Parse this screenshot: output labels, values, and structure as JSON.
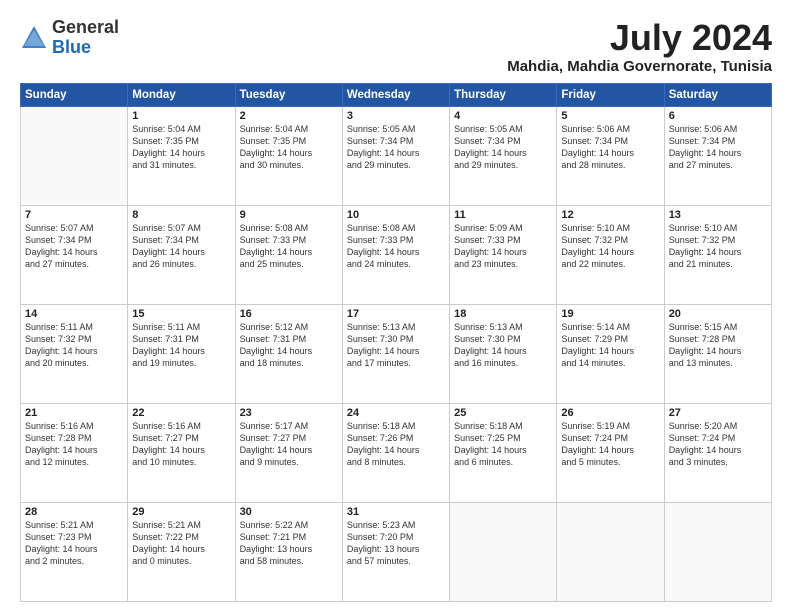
{
  "header": {
    "logo_general": "General",
    "logo_blue": "Blue",
    "month_year": "July 2024",
    "location": "Mahdia, Mahdia Governorate, Tunisia"
  },
  "calendar": {
    "days_of_week": [
      "Sunday",
      "Monday",
      "Tuesday",
      "Wednesday",
      "Thursday",
      "Friday",
      "Saturday"
    ],
    "weeks": [
      [
        {
          "num": "",
          "info": ""
        },
        {
          "num": "1",
          "info": "Sunrise: 5:04 AM\nSunset: 7:35 PM\nDaylight: 14 hours\nand 31 minutes."
        },
        {
          "num": "2",
          "info": "Sunrise: 5:04 AM\nSunset: 7:35 PM\nDaylight: 14 hours\nand 30 minutes."
        },
        {
          "num": "3",
          "info": "Sunrise: 5:05 AM\nSunset: 7:34 PM\nDaylight: 14 hours\nand 29 minutes."
        },
        {
          "num": "4",
          "info": "Sunrise: 5:05 AM\nSunset: 7:34 PM\nDaylight: 14 hours\nand 29 minutes."
        },
        {
          "num": "5",
          "info": "Sunrise: 5:06 AM\nSunset: 7:34 PM\nDaylight: 14 hours\nand 28 minutes."
        },
        {
          "num": "6",
          "info": "Sunrise: 5:06 AM\nSunset: 7:34 PM\nDaylight: 14 hours\nand 27 minutes."
        }
      ],
      [
        {
          "num": "7",
          "info": "Sunrise: 5:07 AM\nSunset: 7:34 PM\nDaylight: 14 hours\nand 27 minutes."
        },
        {
          "num": "8",
          "info": "Sunrise: 5:07 AM\nSunset: 7:34 PM\nDaylight: 14 hours\nand 26 minutes."
        },
        {
          "num": "9",
          "info": "Sunrise: 5:08 AM\nSunset: 7:33 PM\nDaylight: 14 hours\nand 25 minutes."
        },
        {
          "num": "10",
          "info": "Sunrise: 5:08 AM\nSunset: 7:33 PM\nDaylight: 14 hours\nand 24 minutes."
        },
        {
          "num": "11",
          "info": "Sunrise: 5:09 AM\nSunset: 7:33 PM\nDaylight: 14 hours\nand 23 minutes."
        },
        {
          "num": "12",
          "info": "Sunrise: 5:10 AM\nSunset: 7:32 PM\nDaylight: 14 hours\nand 22 minutes."
        },
        {
          "num": "13",
          "info": "Sunrise: 5:10 AM\nSunset: 7:32 PM\nDaylight: 14 hours\nand 21 minutes."
        }
      ],
      [
        {
          "num": "14",
          "info": "Sunrise: 5:11 AM\nSunset: 7:32 PM\nDaylight: 14 hours\nand 20 minutes."
        },
        {
          "num": "15",
          "info": "Sunrise: 5:11 AM\nSunset: 7:31 PM\nDaylight: 14 hours\nand 19 minutes."
        },
        {
          "num": "16",
          "info": "Sunrise: 5:12 AM\nSunset: 7:31 PM\nDaylight: 14 hours\nand 18 minutes."
        },
        {
          "num": "17",
          "info": "Sunrise: 5:13 AM\nSunset: 7:30 PM\nDaylight: 14 hours\nand 17 minutes."
        },
        {
          "num": "18",
          "info": "Sunrise: 5:13 AM\nSunset: 7:30 PM\nDaylight: 14 hours\nand 16 minutes."
        },
        {
          "num": "19",
          "info": "Sunrise: 5:14 AM\nSunset: 7:29 PM\nDaylight: 14 hours\nand 14 minutes."
        },
        {
          "num": "20",
          "info": "Sunrise: 5:15 AM\nSunset: 7:28 PM\nDaylight: 14 hours\nand 13 minutes."
        }
      ],
      [
        {
          "num": "21",
          "info": "Sunrise: 5:16 AM\nSunset: 7:28 PM\nDaylight: 14 hours\nand 12 minutes."
        },
        {
          "num": "22",
          "info": "Sunrise: 5:16 AM\nSunset: 7:27 PM\nDaylight: 14 hours\nand 10 minutes."
        },
        {
          "num": "23",
          "info": "Sunrise: 5:17 AM\nSunset: 7:27 PM\nDaylight: 14 hours\nand 9 minutes."
        },
        {
          "num": "24",
          "info": "Sunrise: 5:18 AM\nSunset: 7:26 PM\nDaylight: 14 hours\nand 8 minutes."
        },
        {
          "num": "25",
          "info": "Sunrise: 5:18 AM\nSunset: 7:25 PM\nDaylight: 14 hours\nand 6 minutes."
        },
        {
          "num": "26",
          "info": "Sunrise: 5:19 AM\nSunset: 7:24 PM\nDaylight: 14 hours\nand 5 minutes."
        },
        {
          "num": "27",
          "info": "Sunrise: 5:20 AM\nSunset: 7:24 PM\nDaylight: 14 hours\nand 3 minutes."
        }
      ],
      [
        {
          "num": "28",
          "info": "Sunrise: 5:21 AM\nSunset: 7:23 PM\nDaylight: 14 hours\nand 2 minutes."
        },
        {
          "num": "29",
          "info": "Sunrise: 5:21 AM\nSunset: 7:22 PM\nDaylight: 14 hours\nand 0 minutes."
        },
        {
          "num": "30",
          "info": "Sunrise: 5:22 AM\nSunset: 7:21 PM\nDaylight: 13 hours\nand 58 minutes."
        },
        {
          "num": "31",
          "info": "Sunrise: 5:23 AM\nSunset: 7:20 PM\nDaylight: 13 hours\nand 57 minutes."
        },
        {
          "num": "",
          "info": ""
        },
        {
          "num": "",
          "info": ""
        },
        {
          "num": "",
          "info": ""
        }
      ]
    ]
  }
}
